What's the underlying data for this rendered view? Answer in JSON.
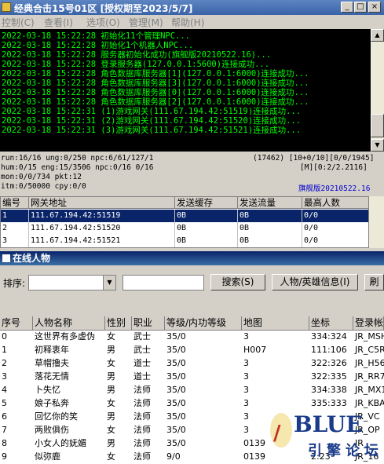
{
  "window": {
    "title": "经典合击15号01区 [授权期至2023/5/7]",
    "buttons": {
      "minimize": "_",
      "maximize": "□",
      "close": "×"
    }
  },
  "menu": [
    "控制(C)",
    "查看(I)",
    "选项(O)",
    "管理(M)",
    "帮助(H)"
  ],
  "log": [
    "2022-03-18 15:22:28 初始化11个管理NPC...",
    "2022-03-18 15:22:28 初始化1个机器人NPC...",
    "2022-03-18 15:22:28 服务器初始化成功(旗舰版20210522.16)...",
    "2022-03-18 15:22:28 登录服务器(127.0.0.1:5600)连接成功...",
    "2022-03-18 15:22:28 角色数据库服务器[1](127.0.0.1:6000)连接成功...",
    "2022-03-18 15:22:28 角色数据库服务器[3](127.0.0.1:6000)连接成功...",
    "2022-03-18 15:22:28 角色数据库服务器[0](127.0.0.1:6000)连接成功...",
    "2022-03-18 15:22:28 角色数据库服务器[2](127.0.0.1:6000)连接成功...",
    "2022-03-18 15:22:31 (1)游戏网关(111.67.194.42:51519)连接成功...",
    "2022-03-18 15:22:31 (2)游戏网关(111.67.194.42:51520)连接成功...",
    "2022-03-18 15:22:31 (3)游戏网关(111.67.194.42:51521)连接成功..."
  ],
  "stats": {
    "line1_left": "run:16/16 ung:0/250 npc:6/61/127/1",
    "line1_right": "(17462) [10+0/10][0/0/1945]",
    "line2_left": "hum:0/15 eng:15/3506 npc:0/16 0/16",
    "line2_right": "[M][0:2/2.2116]",
    "line3_left": "mon:0/0/734 pkt:12",
    "line4_left": "itm:0/50000 cpy:0/0",
    "version": "旗舰版20210522.16",
    "version_color": "#0000cc"
  },
  "gateways": {
    "headers": [
      "编号",
      "网关地址",
      "发送缓存",
      "发送流量",
      "最高人数"
    ],
    "rows": [
      [
        "1",
        "111.67.194.42:51519",
        "0B",
        "0B",
        "0/0"
      ],
      [
        "2",
        "111.67.194.42:51520",
        "0B",
        "0B",
        "0/0"
      ],
      [
        "3",
        "111.67.194.42:51521",
        "0B",
        "0B",
        "0/0"
      ]
    ]
  },
  "online_panel": {
    "title": "在线人物",
    "sort_label": "排序:",
    "sort_value": "",
    "search_value": "",
    "search_button": "搜索(S)",
    "info_button": "人物/英雄信息(I)",
    "extra_button": "刷"
  },
  "players": {
    "headers": [
      "序号",
      "人物名称",
      "性别",
      "职业",
      "等级/内功等级",
      "地图",
      "坐标",
      "登录帐号"
    ],
    "rows": [
      [
        "0",
        "这世界有多虚伪",
        "女",
        "武士",
        "35/0",
        "3",
        "334:324",
        "JR_MSH"
      ],
      [
        "1",
        "初释衷年",
        "男",
        "武士",
        "35/0",
        "H007",
        "111:106",
        "JR_C5R"
      ],
      [
        "2",
        "草帽撸夫",
        "女",
        "道士",
        "35/0",
        "3",
        "322:326",
        "JR_H56"
      ],
      [
        "3",
        "落花无情",
        "男",
        "道士",
        "35/0",
        "3",
        "322:335",
        "JR_RR7"
      ],
      [
        "4",
        "卜失忆",
        "男",
        "法师",
        "35/0",
        "3",
        "334:338",
        "JR_MX1"
      ],
      [
        "5",
        "娘子私奔",
        "女",
        "法师",
        "35/0",
        "3",
        "335:333",
        "JR_KBA"
      ],
      [
        "6",
        "回忆你的笑",
        "男",
        "法师",
        "35/0",
        "3",
        "",
        "JR_VC"
      ],
      [
        "7",
        "两败俱伤",
        "女",
        "法师",
        "35/0",
        "3",
        "",
        "JR_OP"
      ],
      [
        "8",
        "小女人的妩媚",
        "男",
        "法师",
        "35/0",
        "0139",
        "",
        "JR_"
      ],
      [
        "9",
        "似弥鹿",
        "女",
        "法师",
        "9/0",
        "0139",
        "2:23",
        "JR_16"
      ]
    ]
  },
  "watermark": {
    "brand": "BLUE",
    "sub": "引擎论坛"
  }
}
